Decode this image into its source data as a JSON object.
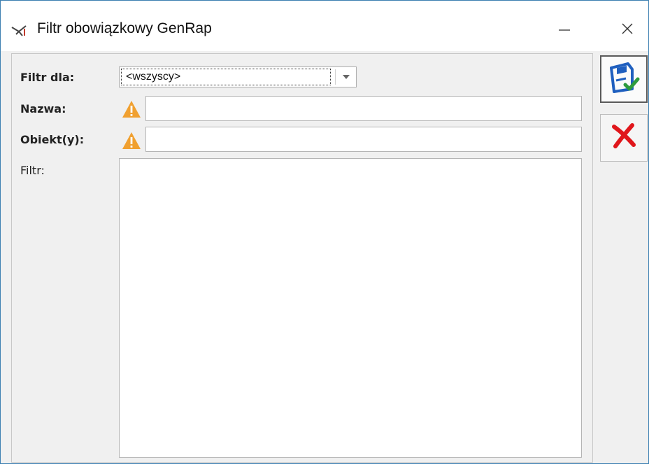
{
  "window": {
    "title": "Filtr obowiązkowy GenRap"
  },
  "titlebar": {
    "icon": "filter-edit-icon",
    "minimize_icon": "minimize-icon",
    "close_icon": "close-icon"
  },
  "form": {
    "filter_for_label": "Filtr dla:",
    "filter_for_value": "<wszyscy>",
    "name_label": "Nazwa:",
    "name_value": "",
    "objects_label": "Obiekt(y):",
    "objects_value": "",
    "filter_label": "Filtr:",
    "filter_value": ""
  },
  "side_buttons": {
    "save_icon": "save-disk-check-icon",
    "cancel_icon": "red-x-cancel-icon"
  },
  "colors": {
    "window_border": "#3c7fb1",
    "warning": "#f0a030",
    "save_blue": "#1f5fbf",
    "save_check": "#2e9b3e",
    "cancel_red": "#e0161b"
  }
}
